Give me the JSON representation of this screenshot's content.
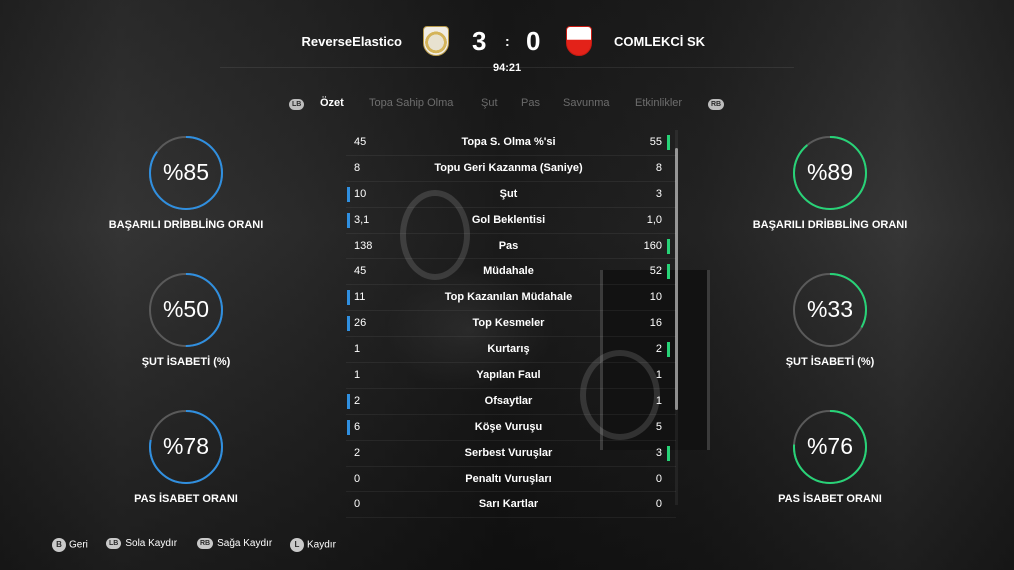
{
  "match": {
    "home_team": "ReverseElastico",
    "away_team": "COMLEKCİ SK",
    "home_score": "3",
    "away_score": "0",
    "separator": ":",
    "clock": "94:21"
  },
  "tabs": {
    "left_bumper": "LB",
    "right_bumper": "RB",
    "items": [
      "Özet",
      "Topa Sahip Olma",
      "Şut",
      "Pas",
      "Savunma",
      "Etkinlikler"
    ],
    "active": "Özet"
  },
  "stats": [
    {
      "name": "Topa S. Olma %'si",
      "home": "45",
      "away": "55",
      "leader": "away"
    },
    {
      "name": "Topu Geri Kazanma (Saniye)",
      "home": "8",
      "away": "8",
      "leader": "none"
    },
    {
      "name": "Şut",
      "home": "10",
      "away": "3",
      "leader": "home"
    },
    {
      "name": "Gol Beklentisi",
      "home": "3,1",
      "away": "1,0",
      "leader": "home"
    },
    {
      "name": "Pas",
      "home": "138",
      "away": "160",
      "leader": "away"
    },
    {
      "name": "Müdahale",
      "home": "45",
      "away": "52",
      "leader": "away"
    },
    {
      "name": "Top Kazanılan Müdahale",
      "home": "11",
      "away": "10",
      "leader": "home"
    },
    {
      "name": "Top Kesmeler",
      "home": "26",
      "away": "16",
      "leader": "home"
    },
    {
      "name": "Kurtarış",
      "home": "1",
      "away": "2",
      "leader": "away"
    },
    {
      "name": "Yapılan Faul",
      "home": "1",
      "away": "1",
      "leader": "none"
    },
    {
      "name": "Ofsaytlar",
      "home": "2",
      "away": "1",
      "leader": "home"
    },
    {
      "name": "Köşe Vuruşu",
      "home": "6",
      "away": "5",
      "leader": "home"
    },
    {
      "name": "Serbest Vuruşlar",
      "home": "2",
      "away": "3",
      "leader": "away"
    },
    {
      "name": "Penaltı Vuruşları",
      "home": "0",
      "away": "0",
      "leader": "none"
    },
    {
      "name": "Sarı Kartlar",
      "home": "0",
      "away": "0",
      "leader": "none"
    }
  ],
  "home_metrics": [
    {
      "value": "%85",
      "label": "BAŞARILI DRİBBLİNG ORANI",
      "fraction": 0.85
    },
    {
      "value": "%50",
      "label": "ŞUT İSABETİ (%)",
      "fraction": 0.5
    },
    {
      "value": "%78",
      "label": "PAS İSABET ORANI",
      "fraction": 0.78
    }
  ],
  "away_metrics": [
    {
      "value": "%89",
      "label": "BAŞARILI DRİBBLİNG ORANI",
      "fraction": 0.89
    },
    {
      "value": "%33",
      "label": "ŞUT İSABETİ (%)",
      "fraction": 0.33
    },
    {
      "value": "%76",
      "label": "PAS İSABET ORANI",
      "fraction": 0.76
    }
  ],
  "colors": {
    "home_accent": "#2f8fe0",
    "away_accent": "#27d377",
    "ring_track": "#5a5a5a"
  },
  "hints": {
    "back_key": "B",
    "back_label": "Geri",
    "left_key": "LB",
    "left_label": "Sola Kaydır",
    "right_key": "RB",
    "right_label": "Sağa Kaydır",
    "scroll_key": "L",
    "scroll_label": "Kaydır"
  }
}
